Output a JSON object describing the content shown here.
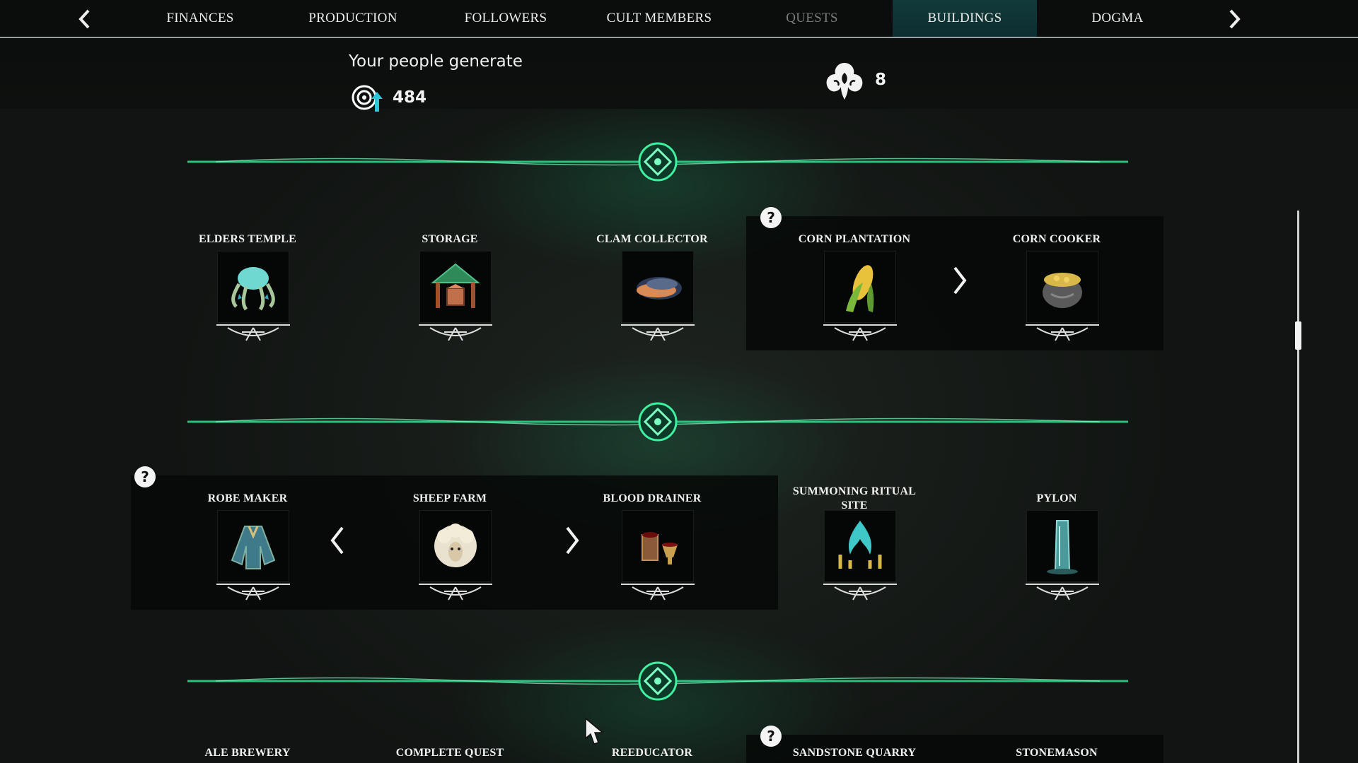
{
  "nav": {
    "prev_icon": "chevron-left-icon",
    "next_icon": "chevron-right-icon",
    "tabs": [
      {
        "label": "FINANCES",
        "state": "normal"
      },
      {
        "label": "PRODUCTION",
        "state": "normal"
      },
      {
        "label": "FOLLOWERS",
        "state": "normal"
      },
      {
        "label": "CULT MEMBERS",
        "state": "normal"
      },
      {
        "label": "QUESTS",
        "state": "disabled"
      },
      {
        "label": "BUILDINGS",
        "state": "active"
      },
      {
        "label": "DOGMA",
        "state": "normal"
      }
    ]
  },
  "stats": {
    "generate_title": "Your people generate",
    "generate_icon": "influence-icon",
    "generate_value": "484",
    "faith_icon": "cult-emblem-icon",
    "faith_value": "8"
  },
  "rows": [
    {
      "buildings": [
        {
          "name": "ELDERS TEMPLE",
          "icon": "octopus-temple-icon"
        },
        {
          "name": "STORAGE",
          "icon": "storage-crate-icon"
        },
        {
          "name": "CLAM COLLECTOR",
          "icon": "clam-icon"
        },
        {
          "name": "CORN PLANTATION",
          "icon": "corn-icon"
        },
        {
          "name": "CORN COOKER",
          "icon": "cooking-pot-icon"
        }
      ],
      "help_icon": "help-icon"
    },
    {
      "buildings": [
        {
          "name": "ROBE MAKER",
          "icon": "robe-icon"
        },
        {
          "name": "SHEEP FARM",
          "icon": "sheep-icon"
        },
        {
          "name": "BLOOD DRAINER",
          "icon": "blood-cups-icon"
        },
        {
          "name": "SUMMONING RITUAL",
          "name2": "SITE",
          "icon": "ritual-flame-icon"
        },
        {
          "name": "PYLON",
          "icon": "pylon-icon"
        }
      ],
      "help_icon": "help-icon"
    },
    {
      "buildings": [
        {
          "name": "ALE BREWERY"
        },
        {
          "name": "COMPLETE QUEST"
        },
        {
          "name": "REEDUCATOR"
        },
        {
          "name": "SANDSTONE QUARRY"
        },
        {
          "name": "STONEMASON"
        }
      ],
      "help_icon": "help-icon"
    }
  ],
  "help_text": "?",
  "colors": {
    "accent": "#2fd38a",
    "active_tab": "#0f3336"
  }
}
